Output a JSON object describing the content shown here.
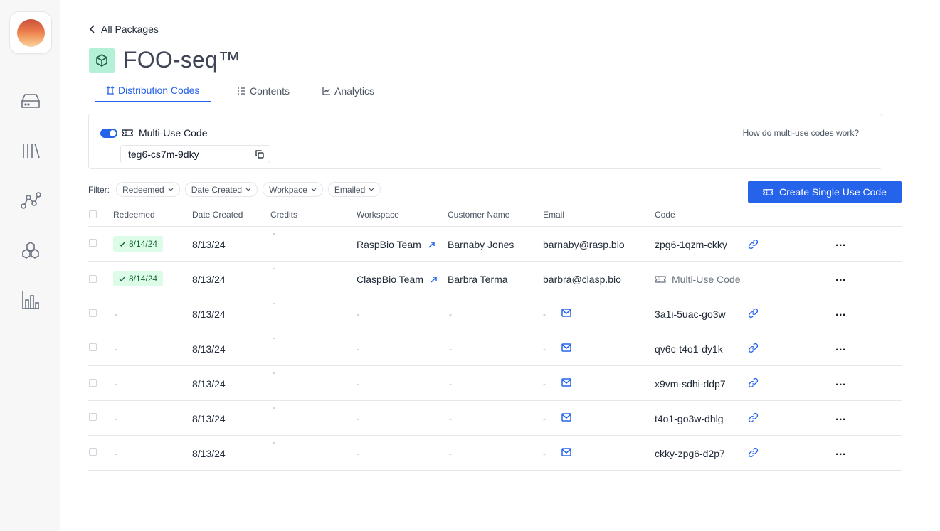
{
  "sidebar": {
    "icons": [
      "drive-icon",
      "library-icon",
      "graph-icon",
      "hexagons-icon",
      "bar-chart-icon"
    ]
  },
  "header": {
    "back_label": "All Packages",
    "title": "FOO-seq™"
  },
  "tabs": [
    {
      "label": "Distribution Codes",
      "active": true
    },
    {
      "label": "Contents",
      "active": false
    },
    {
      "label": "Analytics",
      "active": false
    }
  ],
  "multi_use": {
    "enabled": true,
    "label": "Multi-Use Code",
    "code": "teg6-cs7m-9dky",
    "help_link": "How do multi-use codes work?"
  },
  "filters": {
    "label": "Filter:",
    "chips": [
      "Redeemed",
      "Date Created",
      "Workpace",
      "Emailed"
    ]
  },
  "create_button": "Create Single Use Code",
  "table": {
    "columns": [
      "Redeemed",
      "Date Created",
      "Credits",
      "Workspace",
      "Customer Name",
      "Email",
      "Code"
    ],
    "rows": [
      {
        "redeemed": "8/14/24",
        "date": "8/13/24",
        "credits": "-",
        "workspace": "RaspBio Team",
        "customer": "Barnaby Jones",
        "email": "barnaby@rasp.bio",
        "code": "zpg6-1qzm-ckky"
      },
      {
        "redeemed": "8/14/24",
        "date": "8/13/24",
        "credits": "-",
        "workspace": "ClaspBio Team",
        "customer": "Barbra Terma",
        "email": "barbra@clasp.bio",
        "code": "Multi-Use Code"
      },
      {
        "redeemed": "-",
        "date": "8/13/24",
        "credits": "-",
        "workspace": "-",
        "customer": "-",
        "email": "-",
        "code": "3a1i-5uac-go3w"
      },
      {
        "redeemed": "-",
        "date": "8/13/24",
        "credits": "-",
        "workspace": "-",
        "customer": "-",
        "email": "-",
        "code": "qv6c-t4o1-dy1k"
      },
      {
        "redeemed": "-",
        "date": "8/13/24",
        "credits": "-",
        "workspace": "-",
        "customer": "-",
        "email": "-",
        "code": "x9vm-sdhi-ddp7"
      },
      {
        "redeemed": "-",
        "date": "8/13/24",
        "credits": "-",
        "workspace": "-",
        "customer": "-",
        "email": "-",
        "code": "t4o1-go3w-dhlg"
      },
      {
        "redeemed": "-",
        "date": "8/13/24",
        "credits": "-",
        "workspace": "-",
        "customer": "-",
        "email": "-",
        "code": "ckky-zpg6-d2p7"
      }
    ],
    "more_label": "..."
  },
  "colors": {
    "accent": "#2563eb",
    "badge_bg": "#dcfce7",
    "package_badge": "#b3f0d6"
  }
}
